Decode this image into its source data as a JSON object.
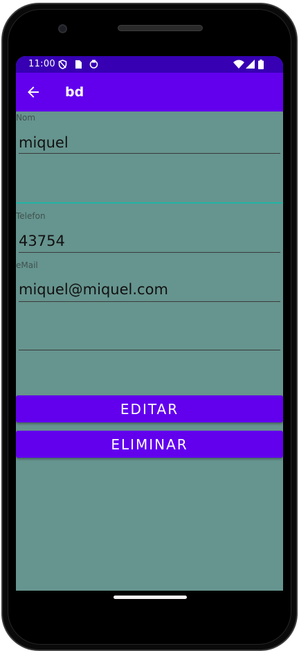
{
  "status_bar": {
    "time": "11:00",
    "icons_left": [
      "shield-icon",
      "sim-card-icon",
      "sync-icon"
    ],
    "icons_right": [
      "wifi-icon",
      "signal-icon",
      "battery-icon"
    ]
  },
  "app_bar": {
    "title": "bd",
    "back_icon": "arrow-left-icon"
  },
  "form": {
    "nom": {
      "label": "Nom",
      "value": "miquel"
    },
    "telefon": {
      "label": "Telefon",
      "value": "43754"
    },
    "email": {
      "label": "eMail",
      "value": "miquel@miquel.com"
    },
    "empty_field_2": {
      "value": ""
    },
    "empty_field_1": {
      "value": ""
    }
  },
  "buttons": {
    "editar": "EDITAR",
    "eliminar": "ELIMINAR"
  },
  "colors": {
    "primary": "#6200ee",
    "primary_dark": "#3700b3",
    "background": "#66948e",
    "focus_accent": "#1fb5a6"
  }
}
